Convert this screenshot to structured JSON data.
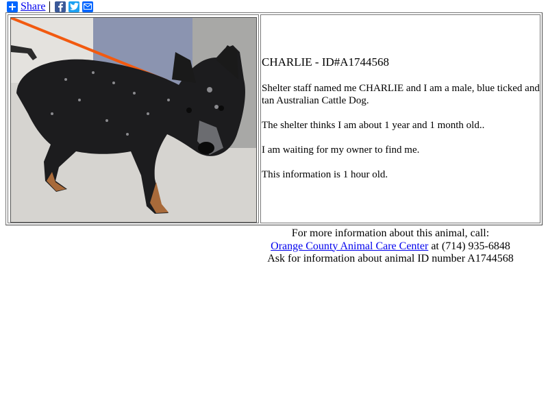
{
  "share": {
    "label": "Share",
    "icons": [
      "plus-icon",
      "facebook-icon",
      "twitter-icon",
      "email-icon"
    ],
    "colors": {
      "link": "#0000ee",
      "plus": "#0166ff",
      "facebook": "#3b5998",
      "twitter": "#1da1f2",
      "email": "#0166ff"
    }
  },
  "animal": {
    "title": "CHARLIE - ID#A1744568",
    "photo_alt": "Photo of CHARLIE",
    "paragraphs": [
      "Shelter staff named me CHARLIE and I am a male, blue ticked and tan Australian Cattle Dog.",
      "The shelter thinks I am about 1 year and 1 month old..",
      "I am waiting for my owner to find me.",
      "This information is 1 hour old."
    ]
  },
  "contact": {
    "line1": "For more information about this animal, call:",
    "shelter_link": "Orange County Animal Care Center",
    "phone_text": " at (714) 935-6848",
    "line3": "Ask for information about animal ID number A1744568"
  }
}
